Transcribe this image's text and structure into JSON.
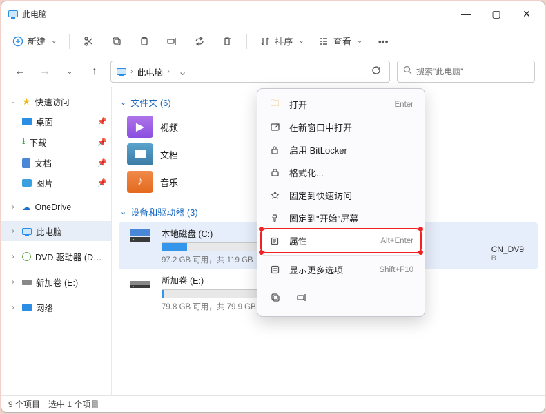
{
  "title": "此电脑",
  "toolbar": {
    "new_label": "新建",
    "sort_label": "排序",
    "view_label": "查看"
  },
  "nav": {
    "crumb": "此电脑"
  },
  "search": {
    "placeholder": "搜索\"此电脑\""
  },
  "sidebar": {
    "quick": "快速访问",
    "desktop": "桌面",
    "downloads": "下载",
    "docs": "文档",
    "pics": "图片",
    "onedrive": "OneDrive",
    "thispc": "此电脑",
    "dvd": "DVD 驱动器 (D:) CC",
    "newvol": "新加卷 (E:)",
    "network": "网络"
  },
  "groups": {
    "folders_label": "文件夹 (6)",
    "devices_label": "设备和驱动器 (3)"
  },
  "folders": {
    "video": "视频",
    "docs": "文档",
    "music": "音乐"
  },
  "drives": {
    "c_name": "本地磁盘 (C:)",
    "c_stat": "97.2 GB 可用，共 119 GB",
    "c_fill_pct": "20%",
    "e_name": "新加卷 (E:)",
    "e_stat": "79.8 GB 可用，共 79.9 GB",
    "e_fill_pct": "1%",
    "right_name": "CN_DV9",
    "right_sub": "B"
  },
  "ctx": {
    "open": "打开",
    "open_sc": "Enter",
    "new_window": "在新窗口中打开",
    "bitlocker": "启用 BitLocker",
    "format": "格式化...",
    "pin_quick": "固定到快速访问",
    "pin_start": "固定到\"开始\"屏幕",
    "props": "属性",
    "props_sc": "Alt+Enter",
    "more": "显示更多选项",
    "more_sc": "Shift+F10"
  },
  "status": {
    "count": "9 个项目",
    "selected": "选中 1 个项目"
  }
}
